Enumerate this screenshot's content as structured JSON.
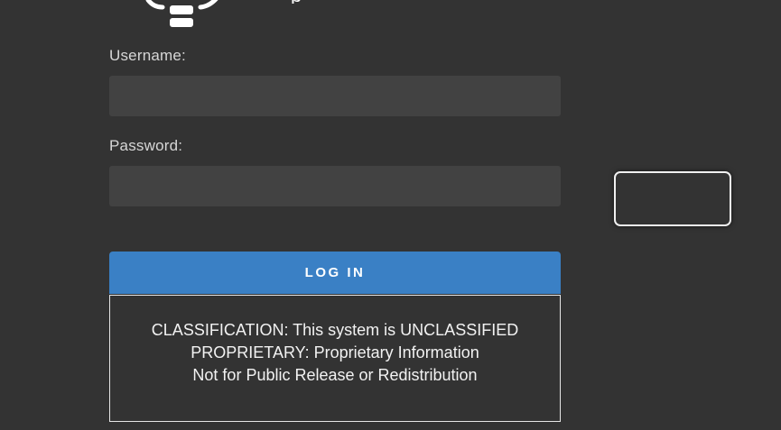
{
  "header": {
    "logo_icon": "lightbulb-icon",
    "app_name_partial": "p"
  },
  "form": {
    "username_label": "Username:",
    "username_value": "",
    "password_label": "Password:",
    "password_value": "",
    "login_label": "LOG IN"
  },
  "classification": {
    "line1": "CLASSIFICATION: This system is UNCLASSIFIED",
    "line2": "PROPRIETARY: Proprietary Information",
    "line3": "Not for Public Release or Redistribution"
  },
  "colors": {
    "background": "#333333",
    "input_background": "#424242",
    "login_button": "#3a80c5",
    "border": "#e6e6e6"
  }
}
